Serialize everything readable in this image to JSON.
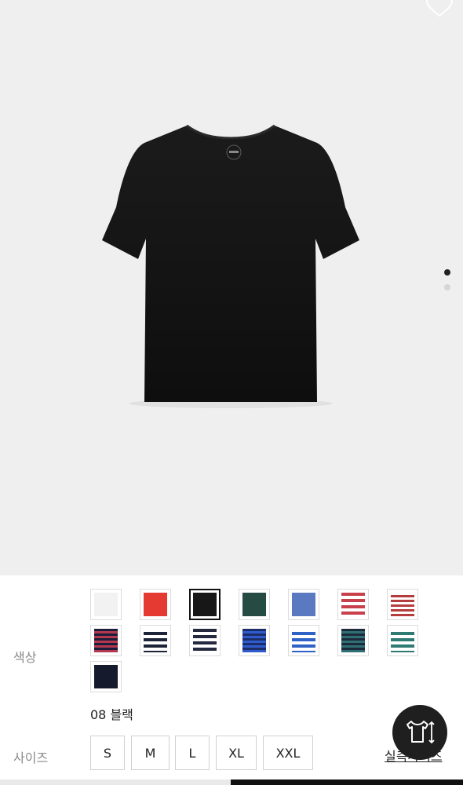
{
  "product": {
    "images": [
      {
        "name": "black-tshirt"
      },
      {
        "name": "image-2"
      }
    ],
    "active_image_index": 0
  },
  "options": {
    "color_label": "색상",
    "selected_color_name": "08 블랙",
    "colors": [
      {
        "name": "white",
        "pattern": "solid",
        "colors": [
          "#f2f2f2"
        ],
        "selected": false
      },
      {
        "name": "red",
        "pattern": "solid",
        "colors": [
          "#e53a32"
        ],
        "selected": false
      },
      {
        "name": "black",
        "pattern": "solid",
        "colors": [
          "#171717"
        ],
        "selected": true
      },
      {
        "name": "dark-green",
        "pattern": "solid",
        "colors": [
          "#254b43"
        ],
        "selected": false
      },
      {
        "name": "blue",
        "pattern": "solid",
        "colors": [
          "#5b79c1"
        ],
        "selected": false
      },
      {
        "name": "red-white-stripe",
        "pattern": "stripe",
        "colors": [
          "#c8404c",
          "#ffffff"
        ],
        "selected": false
      },
      {
        "name": "white-red-stripe",
        "pattern": "stripe-thin",
        "colors": [
          "#ffffff",
          "#b63d3d"
        ],
        "selected": false
      },
      {
        "name": "navy-red-stripe",
        "pattern": "stripe-thin",
        "colors": [
          "#1b1d3a",
          "#b43750"
        ],
        "selected": false
      },
      {
        "name": "white-navy-stripe",
        "pattern": "stripe",
        "colors": [
          "#ffffff",
          "#1d2438"
        ],
        "selected": false
      },
      {
        "name": "navy-white-stripe",
        "pattern": "stripe",
        "colors": [
          "#24293f",
          "#ffffff"
        ],
        "selected": false
      },
      {
        "name": "navy-blue-stripe",
        "pattern": "stripe-thin",
        "colors": [
          "#1c2e69",
          "#2f5bcc"
        ],
        "selected": false
      },
      {
        "name": "white-blue-stripe",
        "pattern": "stripe",
        "colors": [
          "#ffffff",
          "#2e62c6"
        ],
        "selected": false
      },
      {
        "name": "navy-teal-stripe",
        "pattern": "stripe-thin",
        "colors": [
          "#1d2a3b",
          "#2f6f73"
        ],
        "selected": false
      },
      {
        "name": "white-teal-stripe",
        "pattern": "stripe",
        "colors": [
          "#ffffff",
          "#2f7a72"
        ],
        "selected": false
      },
      {
        "name": "navy",
        "pattern": "solid",
        "colors": [
          "#151b2d"
        ],
        "selected": false
      }
    ],
    "size_label": "사이즈",
    "sizes": [
      "S",
      "M",
      "L",
      "XL",
      "XXL"
    ],
    "size_guide_label": "실측사이즈"
  }
}
